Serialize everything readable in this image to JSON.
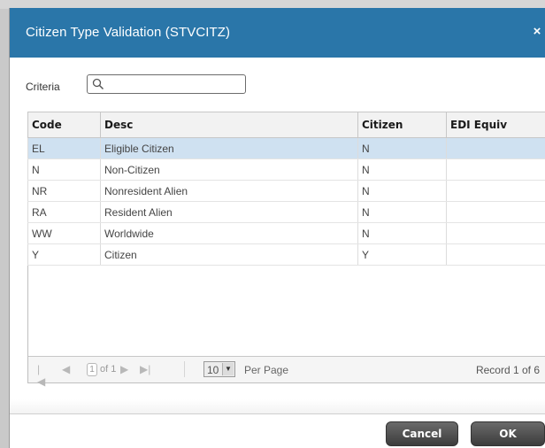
{
  "dialog": {
    "title": "Citizen Type Validation (STVCITZ)",
    "close_glyph": "×"
  },
  "criteria": {
    "label": "Criteria",
    "value": "",
    "placeholder": ""
  },
  "table": {
    "columns": [
      "Code",
      "Desc",
      "Citizen",
      "EDI Equiv"
    ],
    "rows": [
      {
        "code": "EL",
        "desc": "Eligible Citizen",
        "citizen": "N",
        "edi": ""
      },
      {
        "code": "N",
        "desc": "Non-Citizen",
        "citizen": "N",
        "edi": ""
      },
      {
        "code": "NR",
        "desc": "Nonresident Alien",
        "citizen": "N",
        "edi": ""
      },
      {
        "code": "RA",
        "desc": "Resident Alien",
        "citizen": "N",
        "edi": ""
      },
      {
        "code": "WW",
        "desc": "Worldwide",
        "citizen": "N",
        "edi": ""
      },
      {
        "code": "Y",
        "desc": "Citizen",
        "citizen": "Y",
        "edi": ""
      }
    ]
  },
  "pager": {
    "page": "1",
    "of_pages": "of 1",
    "per_page": "10",
    "per_page_label": "Per Page",
    "record_text": "Record 1 of 6"
  },
  "buttons": {
    "cancel": "Cancel",
    "ok": "OK"
  },
  "colors": {
    "titlebar": "#2a76a9",
    "selected_row": "#cfe1f1"
  }
}
